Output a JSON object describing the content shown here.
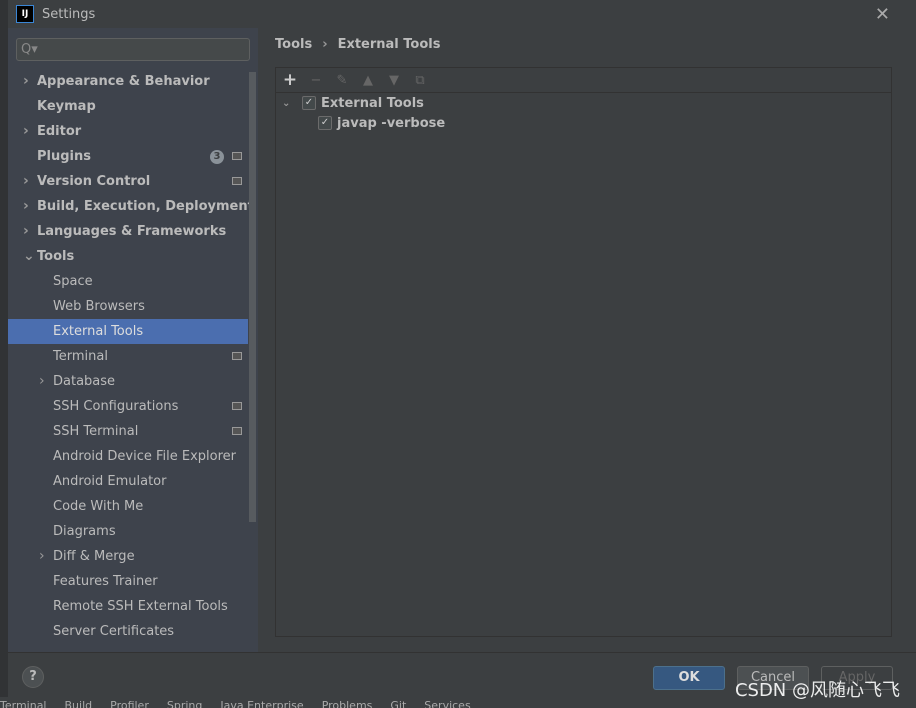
{
  "window": {
    "title": "Settings",
    "logo": "IJ"
  },
  "search": {
    "placeholder": "Q▾"
  },
  "sidebar": {
    "items": [
      {
        "label": "Appearance & Behavior",
        "level": 0,
        "bold": true,
        "expandable": true
      },
      {
        "label": "Keymap",
        "level": 0,
        "bold": true
      },
      {
        "label": "Editor",
        "level": 0,
        "bold": true,
        "expandable": true
      },
      {
        "label": "Plugins",
        "level": 0,
        "bold": true,
        "badge": "3",
        "project": true
      },
      {
        "label": "Version Control",
        "level": 0,
        "bold": true,
        "expandable": true,
        "project": true
      },
      {
        "label": "Build, Execution, Deployment",
        "level": 0,
        "bold": true,
        "expandable": true
      },
      {
        "label": "Languages & Frameworks",
        "level": 0,
        "bold": true,
        "expandable": true
      },
      {
        "label": "Tools",
        "level": 0,
        "bold": true,
        "expanded": true
      },
      {
        "label": "Space",
        "level": 1
      },
      {
        "label": "Web Browsers",
        "level": 1
      },
      {
        "label": "External Tools",
        "level": 1,
        "selected": true
      },
      {
        "label": "Terminal",
        "level": 1,
        "project": true
      },
      {
        "label": "Database",
        "level": 1,
        "expandable": true
      },
      {
        "label": "SSH Configurations",
        "level": 1,
        "project": true
      },
      {
        "label": "SSH Terminal",
        "level": 1,
        "project": true
      },
      {
        "label": "Android Device File Explorer",
        "level": 1
      },
      {
        "label": "Android Emulator",
        "level": 1
      },
      {
        "label": "Code With Me",
        "level": 1
      },
      {
        "label": "Diagrams",
        "level": 1
      },
      {
        "label": "Diff & Merge",
        "level": 1,
        "expandable": true
      },
      {
        "label": "Features Trainer",
        "level": 1
      },
      {
        "label": "Remote SSH External Tools",
        "level": 1
      },
      {
        "label": "Server Certificates",
        "level": 1
      }
    ]
  },
  "breadcrumb": {
    "parent": "Tools",
    "current": "External Tools"
  },
  "toolbar": {
    "add": "+",
    "remove": "−",
    "edit": "✎",
    "up": "▲",
    "down": "▼",
    "copy": "⧉"
  },
  "tree": {
    "group": {
      "label": "External Tools",
      "checked": true
    },
    "items": [
      {
        "label": "javap -verbose",
        "checked": true
      }
    ]
  },
  "buttons": {
    "help": "?",
    "ok": "OK",
    "cancel": "Cancel",
    "apply": "Apply"
  },
  "statusbar": [
    "Terminal",
    "Build",
    "Profiler",
    "Spring",
    "Java Enterprise",
    "Problems",
    "Git",
    "Services"
  ],
  "watermark": "CSDN @风随心飞飞",
  "colors": {
    "selection": "#4b6eaf",
    "ok_button": "#365880"
  }
}
